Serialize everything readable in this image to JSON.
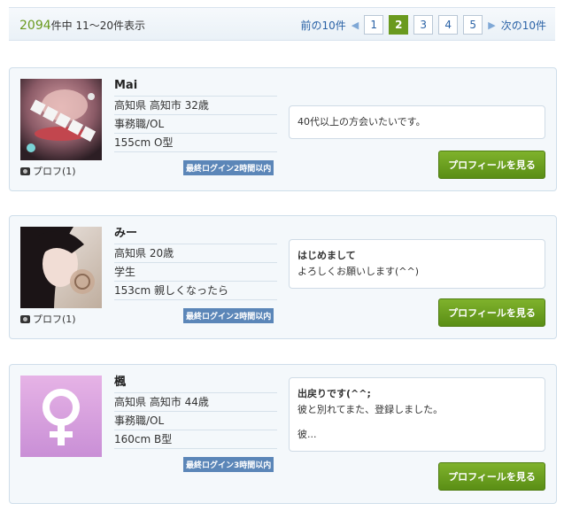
{
  "header": {
    "total": "2094",
    "range_text": "件中 11～20件表示",
    "prev_label": "前の10件",
    "next_label": "次の10件",
    "pages": [
      "1",
      "2",
      "3",
      "4",
      "5"
    ],
    "current_page": "2"
  },
  "profiles": [
    {
      "name": "Mai",
      "location_age": "高知県 高知市  32歳",
      "occupation": "事務職/OL",
      "height_blood": "155cm  O型",
      "photo_count": "プロフ(1)",
      "login_badge": "最終ログイン2時間以内",
      "message_title": "",
      "message_lines": [
        "40代以上の方会いたいです。"
      ],
      "button_label": "プロフィールを見る"
    },
    {
      "name": "みー",
      "location_age": "高知県  20歳",
      "occupation": "学生",
      "height_blood": "153cm  親しくなったら",
      "photo_count": "プロフ(1)",
      "login_badge": "最終ログイン2時間以内",
      "message_title": "はじめまして",
      "message_lines": [
        "よろしくお願いします(^^)"
      ],
      "button_label": "プロフィールを見る"
    },
    {
      "name": "楓",
      "location_age": "高知県 高知市  44歳",
      "occupation": "事務職/OL",
      "height_blood": "160cm  B型",
      "photo_count": "",
      "login_badge": "最終ログイン3時間以内",
      "message_title": "出戻りです(^^;",
      "message_lines": [
        "彼と別れてまた、登録しました。",
        "",
        "彼..."
      ],
      "button_label": "プロフィールを見る"
    }
  ],
  "colors": {
    "accent_green": "#6a9a1f",
    "link_blue": "#2a62a6",
    "badge_blue": "#5b86b8"
  }
}
